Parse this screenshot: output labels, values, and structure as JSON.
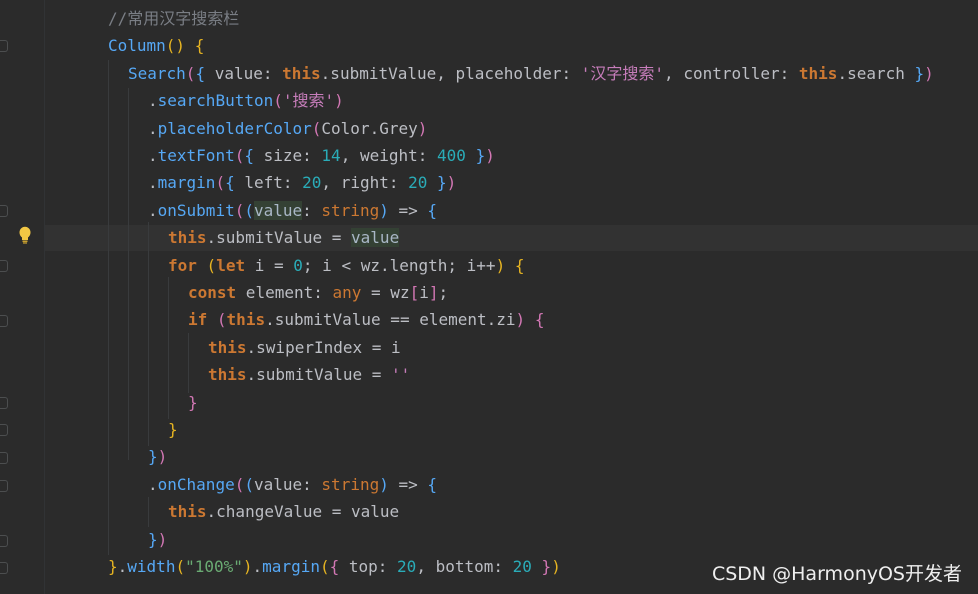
{
  "editor": {
    "theme": {
      "background": "#2b2b2b",
      "accent": "#56a8f5"
    },
    "lines": [
      {
        "t": [
          [
            "cm",
            "//常用汉字搜索栏"
          ]
        ]
      },
      {
        "t": [
          [
            "fn",
            "Column"
          ],
          [
            "b1",
            "()"
          ],
          [
            "pr",
            " "
          ],
          [
            "b1",
            "{"
          ]
        ]
      },
      {
        "t": [
          [
            "fn",
            "Search"
          ],
          [
            "b2",
            "("
          ],
          [
            "b3",
            "{"
          ],
          [
            "pr",
            " value: "
          ],
          [
            "th",
            "this"
          ],
          [
            "pr",
            ".submitValue, placeholder: "
          ],
          [
            "str2",
            "'汉字搜索'"
          ],
          [
            "pr",
            ", controller: "
          ],
          [
            "th",
            "this"
          ],
          [
            "pr",
            ".search "
          ],
          [
            "b3",
            "}"
          ],
          [
            "b2",
            ")"
          ]
        ]
      },
      {
        "t": [
          [
            "pr",
            "."
          ],
          [
            "fn",
            "searchButton"
          ],
          [
            "b2",
            "("
          ],
          [
            "str2",
            "'搜索'"
          ],
          [
            "b2",
            ")"
          ]
        ]
      },
      {
        "t": [
          [
            "pr",
            "."
          ],
          [
            "fn",
            "placeholderColor"
          ],
          [
            "b2",
            "("
          ],
          [
            "pr",
            "Color.Grey"
          ],
          [
            "b2",
            ")"
          ]
        ]
      },
      {
        "t": [
          [
            "pr",
            "."
          ],
          [
            "fn",
            "textFont"
          ],
          [
            "b2",
            "("
          ],
          [
            "b3",
            "{"
          ],
          [
            "pr",
            " size: "
          ],
          [
            "num",
            "14"
          ],
          [
            "pr",
            ", weight: "
          ],
          [
            "num",
            "400"
          ],
          [
            "pr",
            " "
          ],
          [
            "b3",
            "}"
          ],
          [
            "b2",
            ")"
          ]
        ]
      },
      {
        "t": [
          [
            "pr",
            "."
          ],
          [
            "fn",
            "margin"
          ],
          [
            "b2",
            "("
          ],
          [
            "b3",
            "{"
          ],
          [
            "pr",
            " left: "
          ],
          [
            "num",
            "20"
          ],
          [
            "pr",
            ", right: "
          ],
          [
            "num",
            "20"
          ],
          [
            "pr",
            " "
          ],
          [
            "b3",
            "}"
          ],
          [
            "b2",
            ")"
          ]
        ]
      },
      {
        "t": [
          [
            "pr",
            "."
          ],
          [
            "fn",
            "onSubmit"
          ],
          [
            "b2",
            "("
          ],
          [
            "b3",
            "("
          ],
          [
            "hl",
            "value"
          ],
          [
            "pr",
            ": "
          ],
          [
            "ty",
            "string"
          ],
          [
            "b3",
            ")"
          ],
          [
            "pr",
            " => "
          ],
          [
            "b3",
            "{"
          ]
        ]
      },
      {
        "t": [
          [
            "th",
            "this"
          ],
          [
            "pr",
            ".submitValue = "
          ],
          [
            "hl",
            "value"
          ]
        ]
      },
      {
        "t": [
          [
            "kw",
            "for"
          ],
          [
            "pr",
            " "
          ],
          [
            "b1",
            "("
          ],
          [
            "kw",
            "let"
          ],
          [
            "pr",
            " i = "
          ],
          [
            "num",
            "0"
          ],
          [
            "pr",
            "; i < wz.length; i++"
          ],
          [
            "b1",
            ")"
          ],
          [
            "pr",
            " "
          ],
          [
            "b1",
            "{"
          ]
        ]
      },
      {
        "t": [
          [
            "kw",
            "const"
          ],
          [
            "pr",
            " element: "
          ],
          [
            "ty",
            "any"
          ],
          [
            "pr",
            " = wz"
          ],
          [
            "b2",
            "["
          ],
          [
            "pr",
            "i"
          ],
          [
            "b2",
            "]"
          ],
          [
            "pr",
            ";"
          ]
        ]
      },
      {
        "t": [
          [
            "kw",
            "if"
          ],
          [
            "pr",
            " "
          ],
          [
            "b2",
            "("
          ],
          [
            "th",
            "this"
          ],
          [
            "pr",
            ".submitValue == element.zi"
          ],
          [
            "b2",
            ")"
          ],
          [
            "pr",
            " "
          ],
          [
            "b2",
            "{"
          ]
        ]
      },
      {
        "t": [
          [
            "th",
            "this"
          ],
          [
            "pr",
            ".swiperIndex = i"
          ]
        ]
      },
      {
        "t": [
          [
            "th",
            "this"
          ],
          [
            "pr",
            ".submitValue = "
          ],
          [
            "str2",
            "''"
          ]
        ]
      },
      {
        "t": [
          [
            "b2",
            "}"
          ]
        ]
      },
      {
        "t": [
          [
            "b1",
            "}"
          ]
        ]
      },
      {
        "t": [
          [
            "b3",
            "}"
          ],
          [
            "b2",
            ")"
          ]
        ]
      },
      {
        "t": [
          [
            "pr",
            "."
          ],
          [
            "fn",
            "onChange"
          ],
          [
            "b2",
            "("
          ],
          [
            "b3",
            "("
          ],
          [
            "pr",
            "value: "
          ],
          [
            "ty",
            "string"
          ],
          [
            "b3",
            ")"
          ],
          [
            "pr",
            " => "
          ],
          [
            "b3",
            "{"
          ]
        ]
      },
      {
        "t": [
          [
            "th",
            "this"
          ],
          [
            "pr",
            ".changeValue = value"
          ]
        ]
      },
      {
        "t": [
          [
            "b3",
            "}"
          ],
          [
            "b2",
            ")"
          ]
        ]
      },
      {
        "t": [
          [
            "b1",
            "}"
          ],
          [
            "pr",
            "."
          ],
          [
            "fn",
            "width"
          ],
          [
            "b1",
            "("
          ],
          [
            "str",
            "\"100%\""
          ],
          [
            "b1",
            ")"
          ],
          [
            "pr",
            "."
          ],
          [
            "fn",
            "margin"
          ],
          [
            "b1",
            "("
          ],
          [
            "b2",
            "{"
          ],
          [
            "pr",
            " top: "
          ],
          [
            "num",
            "20"
          ],
          [
            "pr",
            ", bottom: "
          ],
          [
            "num",
            "20"
          ],
          [
            "pr",
            " "
          ],
          [
            "b2",
            "}"
          ],
          [
            "b1",
            ")"
          ]
        ]
      }
    ],
    "indents": [
      0,
      0,
      1,
      2,
      2,
      2,
      2,
      2,
      3,
      3,
      4,
      4,
      5,
      5,
      4,
      3,
      2,
      2,
      3,
      2,
      0
    ],
    "gutter_icons": {
      "bulb_line": 9,
      "bulb_icon": "lightbulb-icon"
    }
  },
  "watermark": {
    "text": "CSDN @HarmonyOS开发者"
  }
}
